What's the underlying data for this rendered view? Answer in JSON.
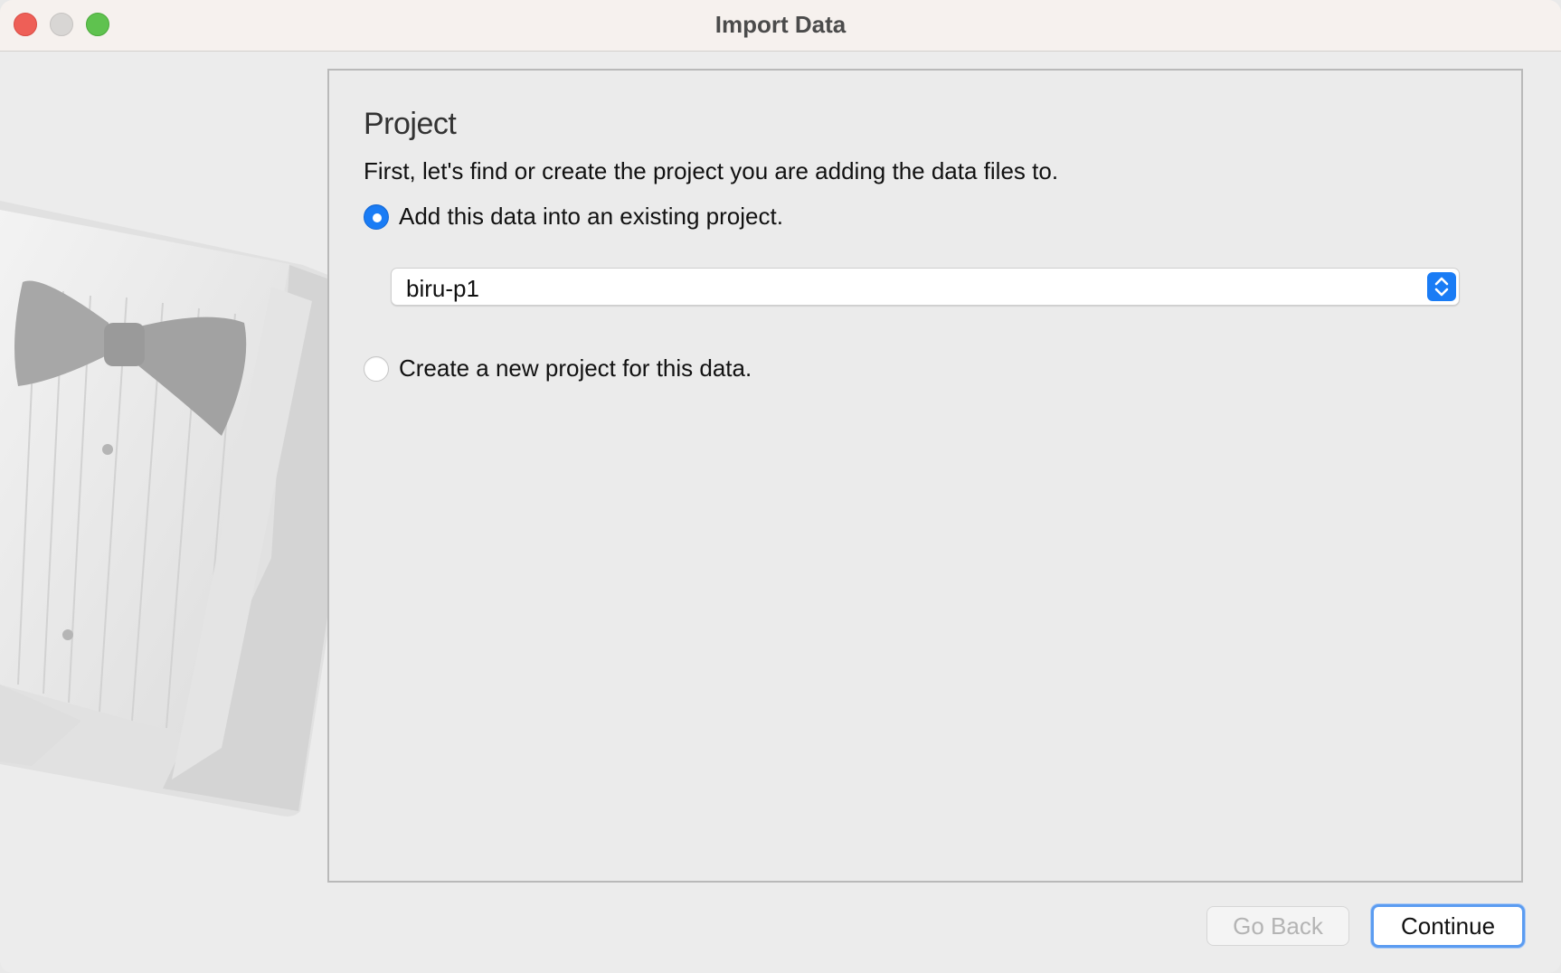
{
  "window": {
    "title": "Import Data"
  },
  "panel": {
    "section_title": "Project",
    "intro": "First, let's find or create the project you are adding the data files to.",
    "options": [
      {
        "label": "Add this data into an existing project.",
        "checked": true
      },
      {
        "label": "Create a new project for this data.",
        "checked": false
      }
    ],
    "project_select": {
      "value": "biru-p1"
    }
  },
  "footer": {
    "back_label": "Go Back",
    "continue_label": "Continue"
  },
  "colors": {
    "accent": "#1a7cf5",
    "titlebar": "#f6f1ee",
    "close": "#ee5f57",
    "minimize": "#d8d6d4",
    "maximize": "#5fc24f"
  },
  "icons": {
    "illustration": "tuxedo-illustration",
    "stepper": "up-down-chevron-icon"
  }
}
